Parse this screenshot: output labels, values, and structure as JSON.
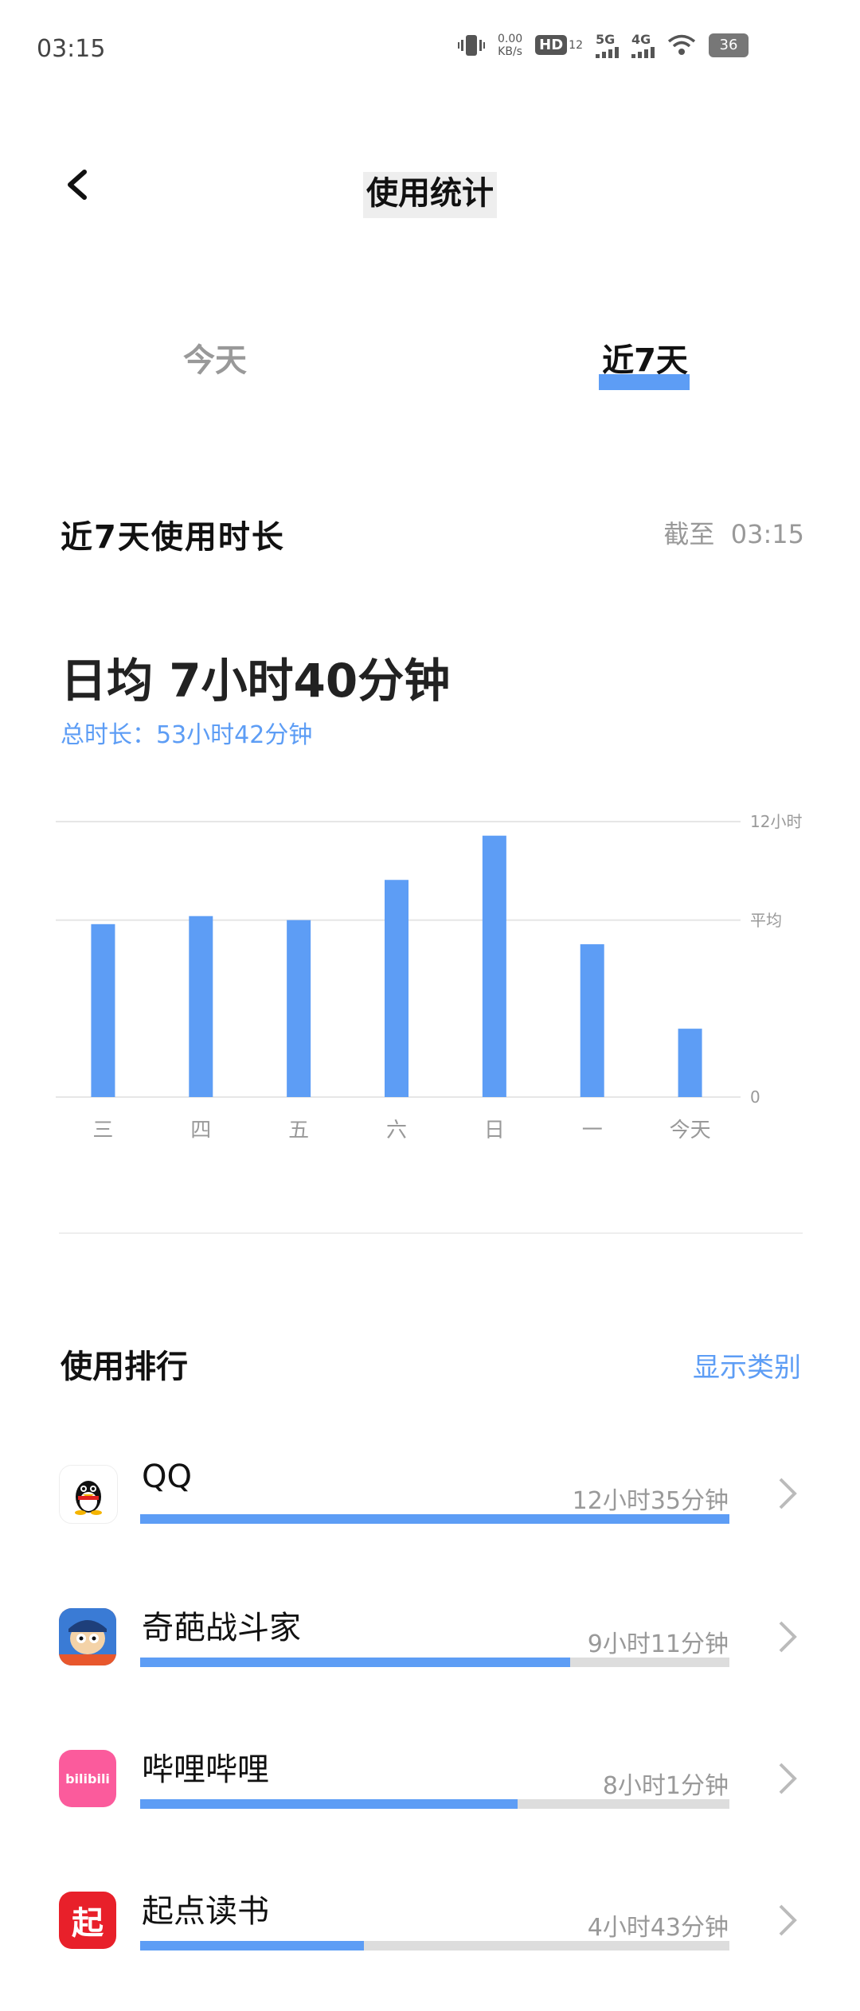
{
  "status_bar": {
    "time": "03:15",
    "net_speed_value": "0.00",
    "net_speed_unit": "KB/s",
    "hd": "HD",
    "hd_sub": "12",
    "net1": "5G",
    "net2": "4G",
    "battery": "36"
  },
  "header": {
    "title": "使用统计"
  },
  "tabs": [
    {
      "label": "今天",
      "active": false
    },
    {
      "label": "近7天",
      "active": true
    }
  ],
  "summary": {
    "section_title": "近7天使用时长",
    "cutoff_label": "截至",
    "cutoff_time": "03:15",
    "daily_avg": "日均 7小时40分钟",
    "total": "总时长：53小时42分钟"
  },
  "chart_data": {
    "type": "bar",
    "categories": [
      "三",
      "四",
      "五",
      "六",
      "日",
      "一",
      "今天"
    ],
    "values": [
      8.6,
      9.0,
      8.8,
      10.8,
      13.0,
      7.6,
      3.4
    ],
    "ylim": [
      0,
      13.7
    ],
    "reference_lines": [
      {
        "label": "12小时",
        "value": 13.7
      },
      {
        "label": "平均",
        "value": 8.8
      },
      {
        "label": "0",
        "value": 0
      }
    ],
    "color": "#5d9df5"
  },
  "ranking": {
    "title": "使用排行",
    "show_category": "显示类别",
    "apps": [
      {
        "name": "QQ",
        "time": "12小时35分钟",
        "fraction": 1.0,
        "icon": "qq-icon"
      },
      {
        "name": "奇葩战斗家",
        "time": "9小时11分钟",
        "fraction": 0.73,
        "icon": "game-icon"
      },
      {
        "name": "哔哩哔哩",
        "time": "8小时1分钟",
        "fraction": 0.64,
        "icon": "bilibili-icon",
        "icon_text": "bilibili"
      },
      {
        "name": "起点读书",
        "time": "4小时43分钟",
        "fraction": 0.38,
        "icon": "qidian-icon",
        "icon_text": "起"
      }
    ]
  },
  "colors": {
    "accent": "#5d9df5",
    "muted": "#999999"
  }
}
